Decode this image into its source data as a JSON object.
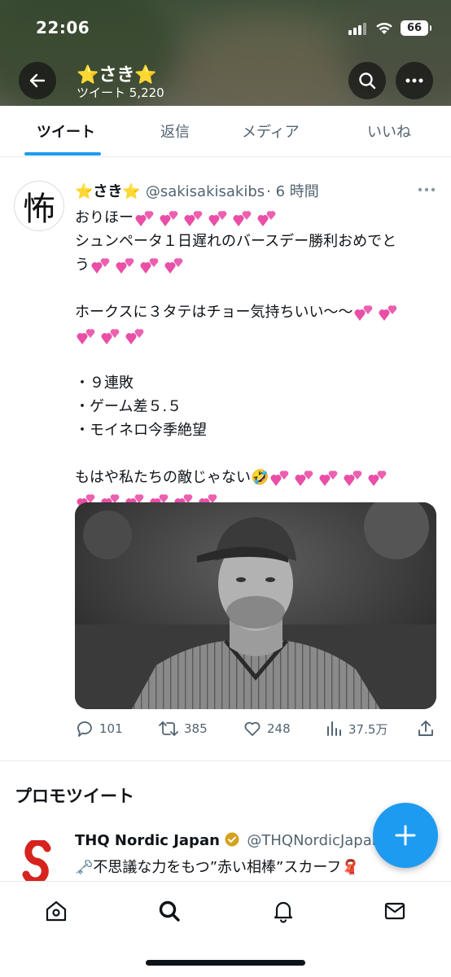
{
  "status_bar": {
    "time": "22:06",
    "battery": "66"
  },
  "profile": {
    "name": "⭐️さき⭐️",
    "tweet_count": "ツイート 5,220"
  },
  "tabs": [
    {
      "label": "ツイート",
      "active": true
    },
    {
      "label": "返信",
      "active": false
    },
    {
      "label": "メディア",
      "active": false
    },
    {
      "label": "いいね",
      "active": false
    }
  ],
  "tweet": {
    "display_name": "⭐️さき⭐️",
    "handle": "@sakisakisakibs",
    "time": "· 6 時間",
    "avatar_char": "怖",
    "lines": [
      {
        "text": "おりほー",
        "hearts": 6
      },
      {
        "text": "シュンペータ１日遅れのバースデー勝利おめでと",
        "hearts": 0
      },
      {
        "text": "う",
        "hearts": 4
      },
      {
        "text": "",
        "hearts": 0
      },
      {
        "text": "ホークスに３タテはチョー気持ちいい〜〜",
        "hearts": 2
      },
      {
        "text": "",
        "hearts": 3
      },
      {
        "text": "",
        "hearts": 0
      },
      {
        "text": "・９連敗",
        "hearts": 0
      },
      {
        "text": "・ゲーム差５.５",
        "hearts": 0
      },
      {
        "text": "・モイネロ今季絶望",
        "hearts": 0
      },
      {
        "text": "",
        "hearts": 0
      },
      {
        "text": "もはや私たちの敵じゃない🤣",
        "hearts": 5
      },
      {
        "text": "",
        "hearts": 6
      }
    ],
    "stats": {
      "replies": "101",
      "retweets": "385",
      "likes": "248",
      "views": "37.5万"
    }
  },
  "promo": {
    "section_title": "プロモツイート",
    "display_name": "THQ Nordic Japan",
    "handle": "@THQNordicJapan",
    "text": "🗝️不思議な力をもつ”赤い相棒”スカーフ🧣"
  },
  "colors": {
    "accent": "#1d9bf0",
    "heart": "#e94fa6",
    "text": "#0f1419",
    "muted": "#536471"
  }
}
